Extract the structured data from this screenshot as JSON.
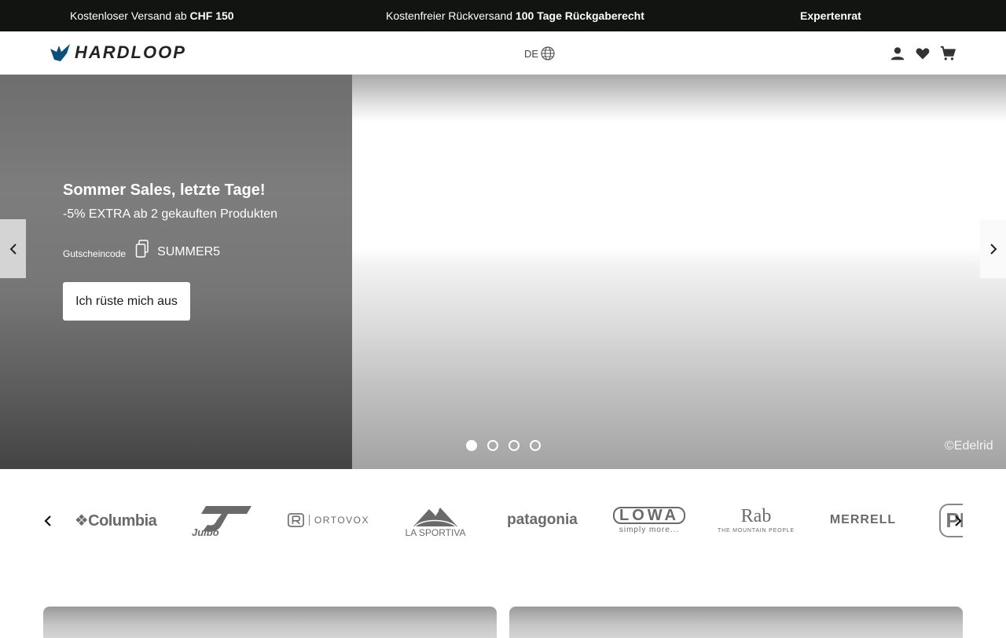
{
  "topbar": {
    "promo1_prefix": "Kostenloser Versand ab ",
    "promo1_strong": "CHF 150",
    "promo2_prefix": "Kostenfreier Rückversand ",
    "promo2_strong": "100 Tage Rückgaberecht",
    "promo3": "Expertenrat"
  },
  "header": {
    "logo_text": "HARDLOOP",
    "language": "DE",
    "icons": [
      "account-icon",
      "wishlist-heart-icon",
      "cart-icon"
    ]
  },
  "hero": {
    "title": "Sommer Sales, letzte Tage!",
    "subtitle": "-5% EXTRA ab 2 gekauften Produkten",
    "coupon_label": "Gutscheincode",
    "coupon_code": "SUMMER5",
    "cta_label": "Ich rüste mich aus",
    "credit": "©Edelrid",
    "slides_total": 4,
    "active_slide": 1
  },
  "brands": {
    "items": [
      {
        "name": "Columbia",
        "label": "❖Columbia"
      },
      {
        "name": "Julbo",
        "label": "Julbo"
      },
      {
        "name": "Ortovox",
        "label": "ORTOVOX"
      },
      {
        "name": "La Sportiva",
        "label": "LA SPORTIVA"
      },
      {
        "name": "Patagonia",
        "label": "patagonia"
      },
      {
        "name": "Lowa",
        "label": "LOWA",
        "tagline": "simply more..."
      },
      {
        "name": "Rab",
        "label": "Rab",
        "tagline": "THE MOUNTAIN PEOPLE"
      },
      {
        "name": "Merrell",
        "label": "MERRELL"
      },
      {
        "name": "partial-brand",
        "label": "PF"
      }
    ]
  },
  "colors": {
    "topbar_bg": "#121411",
    "logo_accent": "#0b4f7a",
    "icon_dark": "#333333"
  }
}
